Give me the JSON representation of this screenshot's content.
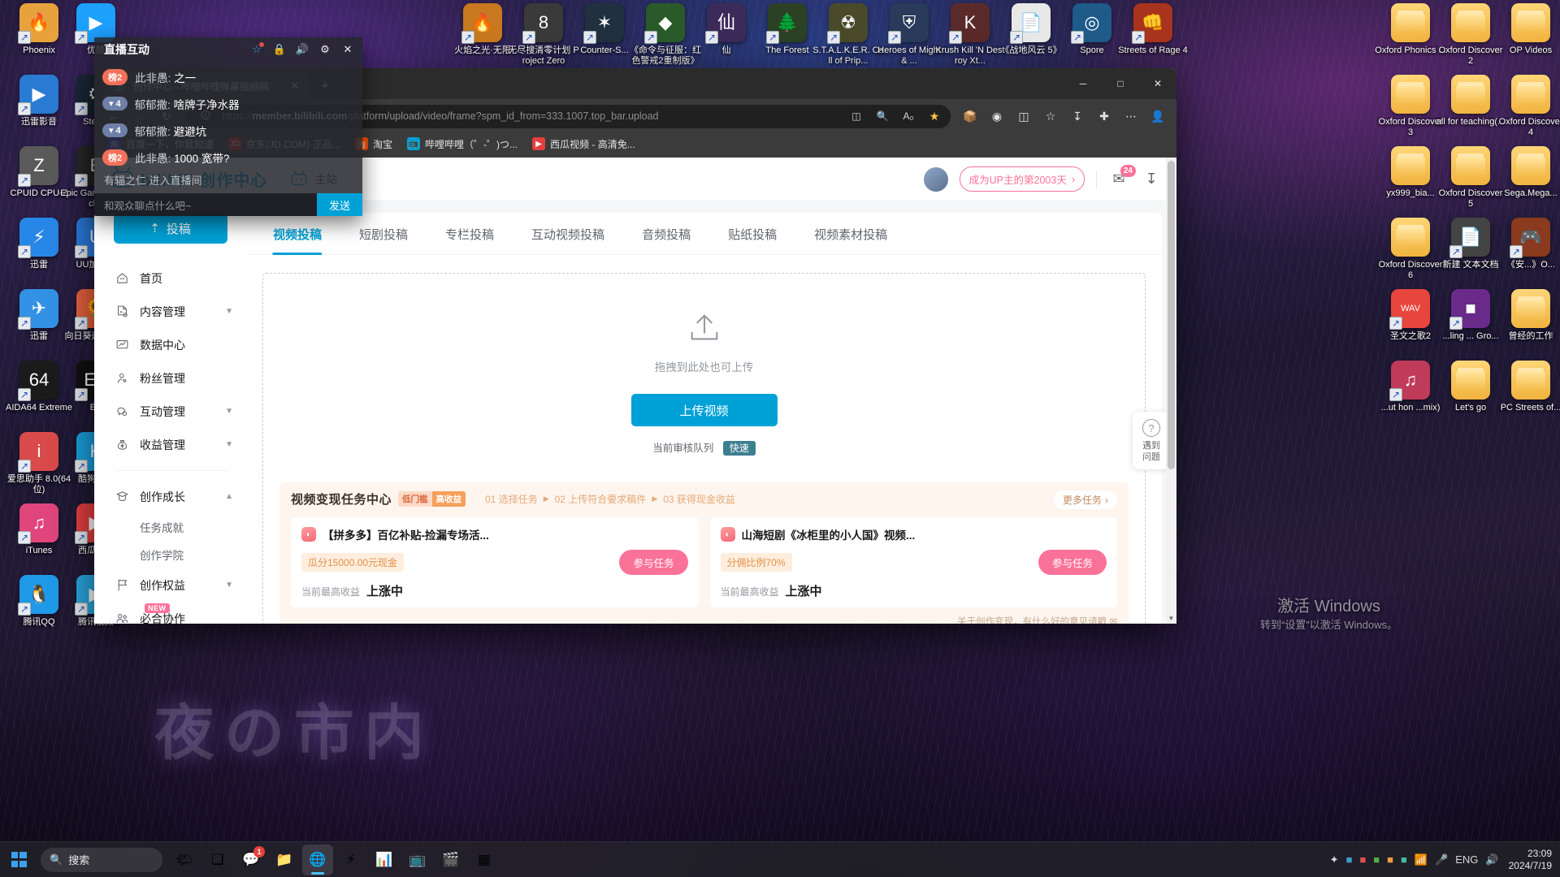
{
  "desktop": {
    "icons_left": [
      {
        "label": "Phoenix",
        "glyph": "🔥",
        "type": "app",
        "color": "#e8a23d"
      },
      {
        "label": "优酷",
        "glyph": "▶",
        "type": "app",
        "color": "#1ea0ff"
      },
      {
        "label": "迅雷影音",
        "glyph": "▶",
        "type": "app",
        "color": "#2a7bd4"
      },
      {
        "label": "Steam",
        "glyph": "⚙",
        "type": "app",
        "color": "#1b2838"
      },
      {
        "label": "CPUID CPU-Z",
        "glyph": "Z",
        "type": "app",
        "color": "#5a5a5a"
      },
      {
        "label": "Epic Games Launche",
        "glyph": "E",
        "type": "app",
        "color": "#2a2a2a"
      },
      {
        "label": "迅雷",
        "glyph": "⚡",
        "type": "app",
        "color": "#2787e8"
      },
      {
        "label": "UU加速器",
        "glyph": "U",
        "type": "app",
        "color": "#2b7de0"
      },
      {
        "label": "迅雷",
        "glyph": "✈",
        "type": "app",
        "color": "#3391e6"
      },
      {
        "label": "向日葵远程控制",
        "glyph": "🌻",
        "type": "app",
        "color": "#e8623d"
      },
      {
        "label": "AIDA64 Extreme",
        "glyph": "64",
        "type": "app",
        "color": "#1b1b1b"
      },
      {
        "label": "EA",
        "glyph": "EA",
        "type": "app",
        "color": "#111"
      },
      {
        "label": "爱思助手 8.0(64位)",
        "glyph": "i",
        "type": "app",
        "color": "#d94a4a"
      },
      {
        "label": "酷狗音乐",
        "glyph": "K",
        "type": "app",
        "color": "#1aa0e0"
      },
      {
        "label": "iTunes",
        "glyph": "♫",
        "type": "app",
        "color": "#e0457b"
      },
      {
        "label": "西瓜视频",
        "glyph": "▶",
        "type": "app",
        "color": "#e63f3f"
      },
      {
        "label": "腾讯QQ",
        "glyph": "🐧",
        "type": "app",
        "color": "#1f9ae8"
      },
      {
        "label": "腾讯视频",
        "glyph": "▶",
        "type": "app",
        "color": "#2aa8e0"
      }
    ],
    "icons_top": [
      {
        "label": "火焰之光·无限",
        "glyph": "🔥",
        "color": "#c8781e"
      },
      {
        "label": "无尽搜清零计划 Project Zero",
        "glyph": "8",
        "color": "#3a3a3a"
      },
      {
        "label": "Counter-S...",
        "glyph": "✶",
        "color": "#20303f"
      },
      {
        "label": "《命令与征服：红色警戒2重制版》",
        "glyph": "◆",
        "color": "#2a5a2a"
      },
      {
        "label": "仙",
        "glyph": "仙",
        "color": "#3b2a5a"
      },
      {
        "label": "The Forest",
        "glyph": "🌲",
        "color": "#2c4024"
      },
      {
        "label": "S.T.A.L.K.E.R. Call of Prip...",
        "glyph": "☢",
        "color": "#4a4a2a"
      },
      {
        "label": "Heroes of Might & ...",
        "glyph": "⛨",
        "color": "#2a3a5a"
      },
      {
        "label": "Krush Kill 'N Destroy Xt...",
        "glyph": "K",
        "color": "#5a2a2a"
      },
      {
        "label": "《战地风云 5》",
        "glyph": "📄",
        "color": "#e8e8e8"
      },
      {
        "label": "Spore",
        "glyph": "◎",
        "color": "#1e5a8a"
      },
      {
        "label": "Streets of Rage 4",
        "glyph": "👊",
        "color": "#a8341e"
      }
    ],
    "icons_right": [
      {
        "label": "Oxford Phonics ...",
        "type": "folder"
      },
      {
        "label": "Oxford Discover 2",
        "type": "folder"
      },
      {
        "label": "OP Videos",
        "type": "folder"
      },
      {
        "label": "Oxford Discover 3",
        "type": "folder"
      },
      {
        "label": "all for teaching(...",
        "type": "folder"
      },
      {
        "label": "Oxford Discover 4",
        "type": "folder"
      },
      {
        "label": "yx999_bia...",
        "type": "folder"
      },
      {
        "label": "Oxford Discover 5",
        "type": "folder"
      },
      {
        "label": "Sega.Mega...",
        "type": "folder"
      },
      {
        "label": "Oxford Discover 6",
        "type": "folder"
      },
      {
        "label": "新建 文本文档",
        "type": "file",
        "glyph": "📄"
      },
      {
        "label": "《安...》O...",
        "type": "app",
        "glyph": "🎮",
        "color": "#8a3a1e"
      },
      {
        "label": "圣文之歌2",
        "type": "file",
        "glyph": "WAV",
        "color": "#e8453c"
      },
      {
        "label": "...ling ... Gro...",
        "type": "app",
        "glyph": "■",
        "color": "#6a2a8a"
      },
      {
        "label": "曾经的工作",
        "type": "folder"
      },
      {
        "label": "...ut hon ...mix)",
        "type": "app",
        "glyph": "♫",
        "color": "#c03a5a"
      },
      {
        "label": "Let's go",
        "type": "folder"
      },
      {
        "label": "PC Streets of...",
        "type": "folder"
      }
    ],
    "watermark": {
      "line1": "激活 Windows",
      "line2": "转到“设置”以激活 Windows。"
    },
    "citytext": "夜の市内"
  },
  "taskbar": {
    "search_placeholder": "搜索",
    "apps": [
      {
        "name": "weather-widget",
        "glyph": "🌤",
        "badge": ""
      },
      {
        "name": "task-view",
        "glyph": "❑",
        "badge": ""
      },
      {
        "name": "messenger",
        "glyph": "💬",
        "badge": "1"
      },
      {
        "name": "file-explorer",
        "glyph": "📁",
        "badge": ""
      },
      {
        "name": "edge-browser",
        "glyph": "🌐",
        "badge": "",
        "active": true
      },
      {
        "name": "thunder-download",
        "glyph": "⚡",
        "badge": ""
      },
      {
        "name": "calculator",
        "glyph": "📊",
        "badge": ""
      },
      {
        "name": "bilibili-app",
        "glyph": "📺",
        "badge": ""
      },
      {
        "name": "media-player",
        "glyph": "🎬",
        "badge": ""
      },
      {
        "name": "tetris-game",
        "glyph": "▦",
        "badge": ""
      }
    ],
    "tray_icons": [
      "✦",
      "📶",
      "🖥",
      "♥",
      "🔋",
      "⚙",
      "🎤",
      "⌨",
      "🔊"
    ],
    "language": "ENG",
    "time": "23:09",
    "date": "2024/7/19"
  },
  "browser": {
    "tab": {
      "title": "创作中心 - 哔哩哔哩弹幕视频网",
      "favicon": "bilibili-tv-icon"
    },
    "newtab_label": "+",
    "window_controls": {
      "minimize": "─",
      "maximize": "□",
      "close": "✕"
    },
    "url": {
      "prefix": "https://",
      "domain": "member.bilibili.com",
      "path": "/platform/upload/video/frame?spm_id_from=333.1007.top_bar.upload"
    },
    "nav_icons": [
      "back-icon",
      "forward-icon",
      "reload-icon"
    ],
    "omnibox_icons": [
      "split-screen-icon",
      "zoom-icon",
      "read-aloud-icon",
      "favorite-star-icon"
    ],
    "toolbar_icons": [
      "collections-icon",
      "copilot-icon",
      "split-icon",
      "favorites-icon",
      "downloads-icon",
      "extensions-icon",
      "settings-more-icon",
      "profile-icon"
    ],
    "bookmarks": [
      {
        "label": "百度一下，你就知道",
        "color": "#2932e1",
        "glyph": "熊"
      },
      {
        "label": "京东(JD.COM)-正品...",
        "color": "#e1251b",
        "glyph": "JD"
      },
      {
        "label": "淘宝",
        "color": "#ff5000",
        "glyph": "淘"
      },
      {
        "label": "哔哩哔哩（゜-゜)つ...",
        "color": "#00a1d6",
        "glyph": "📺"
      },
      {
        "label": "西瓜视频 - 高清免...",
        "color": "#e63f3f",
        "glyph": "▶"
      }
    ]
  },
  "live_overlay": {
    "title": "直播互动",
    "header_icons": [
      "emoji-icon",
      "lock-icon",
      "volume-icon",
      "settings-gear-icon",
      "close-icon"
    ],
    "messages": [
      {
        "badge": "榜2",
        "badge_type": "rank",
        "user": "此非愚:",
        "text": "之一"
      },
      {
        "badge": "4",
        "badge_type": "level",
        "user": "郁郁撒:",
        "text": "啥牌子净水器"
      },
      {
        "badge": "4",
        "badge_type": "level",
        "user": "郁郁撒:",
        "text": "避避坑"
      },
      {
        "badge": "榜2",
        "badge_type": "rank",
        "user": "此非愚:",
        "text": "1000 宽带?"
      }
    ],
    "enter_notice": "有辐之仁 进入直播间",
    "input_placeholder": "和观众聊点什么吧~",
    "send_label": "发送"
  },
  "page": {
    "brand": "bilibili 创作中心",
    "site_link": "主站",
    "up_badge": "成为UP主的第2003天",
    "message_count": "24",
    "header_icons": [
      "message-icon",
      "download-icon"
    ],
    "sidebar": {
      "post_button": "投稿",
      "items": [
        {
          "label": "首页",
          "icon": "home-icon",
          "expandable": false
        },
        {
          "label": "内容管理",
          "icon": "content-file-icon",
          "expandable": true,
          "chevron": "down"
        },
        {
          "label": "数据中心",
          "icon": "chart-icon",
          "expandable": false
        },
        {
          "label": "粉丝管理",
          "icon": "user-heart-icon",
          "expandable": false
        },
        {
          "label": "互动管理",
          "icon": "chat-bubble-icon",
          "expandable": true,
          "chevron": "down"
        },
        {
          "label": "收益管理",
          "icon": "money-bag-icon",
          "expandable": true,
          "chevron": "down"
        }
      ],
      "group": {
        "label": "创作成长",
        "icon": "graduation-cap-icon",
        "chevron": "up",
        "children": [
          "任务成就",
          "创作学院"
        ]
      },
      "items_bottom": [
        {
          "label": "创作权益",
          "icon": "flag-icon",
          "expandable": true,
          "chevron": "down",
          "tag": ""
        },
        {
          "label": "必合协作",
          "icon": "people-icon",
          "expandable": false,
          "tag": "NEW"
        }
      ]
    },
    "tabs": [
      {
        "label": "视频投稿",
        "active": true
      },
      {
        "label": "短剧投稿",
        "active": false
      },
      {
        "label": "专栏投稿",
        "active": false
      },
      {
        "label": "互动视频投稿",
        "active": false
      },
      {
        "label": "音频投稿",
        "active": false
      },
      {
        "label": "贴纸投稿",
        "active": false
      },
      {
        "label": "视频素材投稿",
        "active": false
      }
    ],
    "dropzone": {
      "icon": "upload-cloud-icon",
      "hint": "拖拽到此处也可上传",
      "button": "上传视频",
      "queue_label": "当前审核队列",
      "queue_value": "快速"
    },
    "task_center": {
      "title": "视频变现任务中心",
      "badge_a": "低门槛",
      "badge_b": "高收益",
      "steps": [
        "01 选择任务",
        "02 上传符合要求稿件",
        "03 获得现金收益"
      ],
      "more_label": "更多任务",
      "cards": [
        {
          "title": "【拼多多】百亿补贴-捡漏专场活...",
          "pill": "瓜分15000.00元现金",
          "join": "参与任务",
          "bottom_label": "当前最高收益",
          "bottom_value": "上涨中"
        },
        {
          "title": "山海短剧《冰柜里的小人国》视频...",
          "pill": "分佣比例70%",
          "join": "参与任务",
          "bottom_label": "当前最高收益",
          "bottom_value": "上涨中"
        }
      ],
      "footer": "关于创作变现，有什么好的意见请戳"
    },
    "help_fab": {
      "icon": "question-icon",
      "line1": "遇到",
      "line2": "问题"
    }
  }
}
